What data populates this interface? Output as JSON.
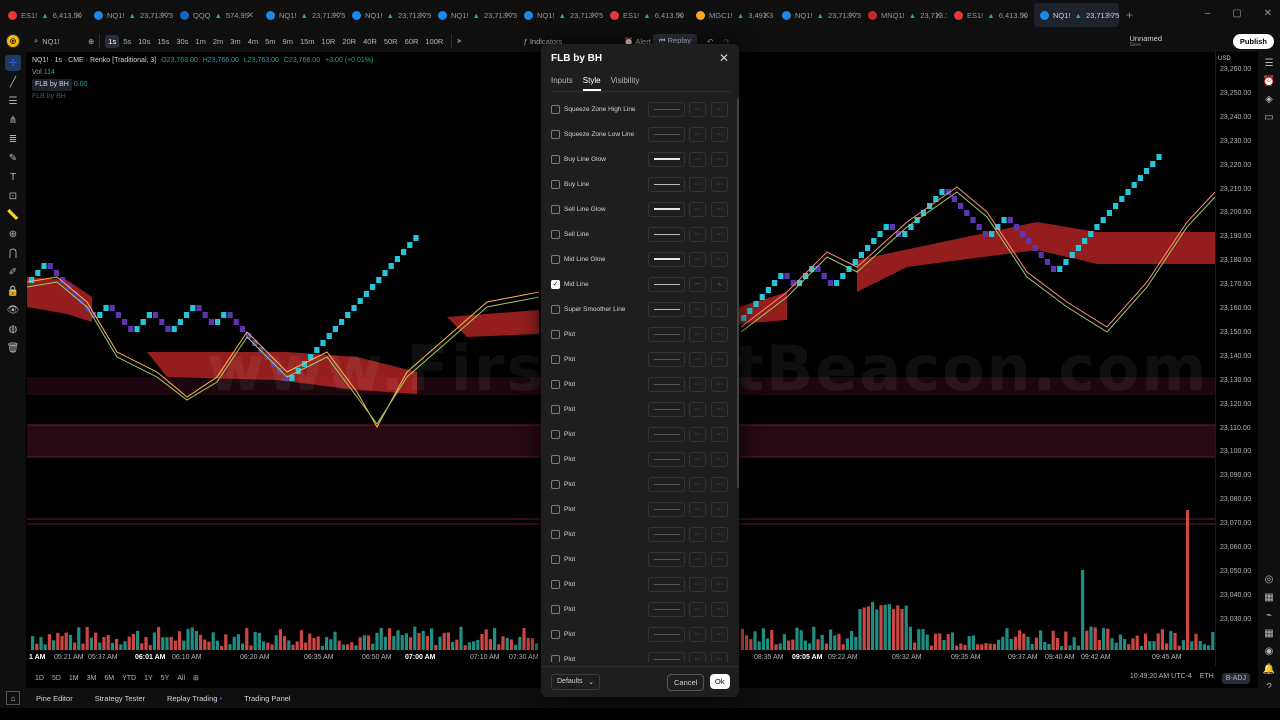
{
  "tabs": [
    {
      "symbol": "ES1!",
      "price": "6,413.50",
      "dot": "#e53935"
    },
    {
      "symbol": "NQ1!",
      "price": "23,713.75",
      "dot": "#1e88e5"
    },
    {
      "symbol": "QQQ",
      "price": "574.95",
      "dot": "#1565c0"
    },
    {
      "symbol": "NQ1!",
      "price": "23,713.75",
      "dot": "#1e88e5"
    },
    {
      "symbol": "NQ1!",
      "price": "23,713.75",
      "dot": "#1e88e5"
    },
    {
      "symbol": "NQ1!",
      "price": "23,713.75",
      "dot": "#1e88e5"
    },
    {
      "symbol": "NQ1!",
      "price": "23,713.75",
      "dot": "#1e88e5"
    },
    {
      "symbol": "ES1!",
      "price": "6,413.50",
      "dot": "#e53935"
    },
    {
      "symbol": "MGC1!",
      "price": "3,491.3",
      "dot": "#f9a825"
    },
    {
      "symbol": "NQ1!",
      "price": "23,713.75",
      "dot": "#1e88e5"
    },
    {
      "symbol": "MNQ1!",
      "price": "23,713.75",
      "dot": "#c62828"
    },
    {
      "symbol": "ES1!",
      "price": "6,413.50",
      "dot": "#e53935"
    },
    {
      "symbol": "NQ1!",
      "price": "23,713.75",
      "dot": "#1e88e5",
      "active": true
    }
  ],
  "toolbar": {
    "symbol": "NQ1!",
    "intervals": [
      "1s",
      "5s",
      "10s",
      "15s",
      "30s",
      "1m",
      "2m",
      "3m",
      "4m",
      "5m",
      "9m",
      "15m",
      "10R",
      "20R",
      "40R",
      "50R",
      "60R",
      "100R"
    ],
    "selected_interval": "1s",
    "indicators": "Indicators",
    "alert": "Alert",
    "replay": "Replay",
    "layout_name": "Unnamed",
    "layout_sub": "Save",
    "publish": "Publish"
  },
  "legend": {
    "title": "NQ1! · 1s · CME · Renko [Traditional, 3]",
    "o": "O23,763.00",
    "h": "H23,766.00",
    "l": "L23,763.00",
    "c": "C23,766.00",
    "chg": "+3.00 (+0.01%)",
    "vol_label": "Vol",
    "vol_value": "114",
    "indicator": "FLB by BH",
    "indicator_value": "0.00",
    "indicator2": "FLB by BH"
  },
  "watermark": "www.FirstLightBeacon.com",
  "price_axis": {
    "currency": "USD",
    "labels": [
      "23,260.00",
      "23,250.00",
      "23,240.00",
      "23,230.00",
      "23,220.00",
      "23,210.00",
      "23,200.00",
      "23,190.00",
      "23,180.00",
      "23,170.00",
      "23,160.00",
      "23,150.00",
      "23,140.00",
      "23,130.00",
      "23,120.00",
      "23,110.00",
      "23,100.00",
      "23,090.00",
      "23,080.00",
      "23,070.00",
      "23,060.00",
      "23,050.00",
      "23,040.00",
      "23,030.00"
    ]
  },
  "time_axis": [
    {
      "label": "1 AM",
      "bold": true
    },
    {
      "label": "05:21 AM"
    },
    {
      "label": "05:37 AM"
    },
    {
      "label": "06:01 AM",
      "bold": true
    },
    {
      "label": "06:10 AM"
    },
    {
      "label": "06:20 AM"
    },
    {
      "label": "06:35 AM"
    },
    {
      "label": "06:50 AM"
    },
    {
      "label": "07:00 AM",
      "bold": true
    },
    {
      "label": "07:10 AM"
    },
    {
      "label": "07:30 AM"
    },
    {
      "label": "08:35 AM"
    },
    {
      "label": "09:05 AM",
      "bold": true
    },
    {
      "label": "09:22 AM"
    },
    {
      "label": "09:32 AM"
    },
    {
      "label": "09:35 AM"
    },
    {
      "label": "09:37 AM"
    },
    {
      "label": "09:40 AM"
    },
    {
      "label": "09:42 AM"
    },
    {
      "label": "09:45 AM"
    }
  ],
  "ranges": [
    "1D",
    "5D",
    "1M",
    "3M",
    "6M",
    "YTD",
    "1Y",
    "5Y",
    "All"
  ],
  "status": {
    "time": "10:49:20 AM UTC-4",
    "session": "ETH",
    "adj": "B-ADJ"
  },
  "bottom_panel": [
    "Pine Editor",
    "Strategy Tester",
    "Replay Trading",
    "Trading Panel"
  ],
  "dialog": {
    "title": "FLB by BH",
    "tabs": [
      "Inputs",
      "Style",
      "Visibility"
    ],
    "active_tab": "Style",
    "rows": [
      {
        "label": "Squeeze Zone High Line",
        "checked": false,
        "glow": false
      },
      {
        "label": "Squeeze Zone Low Line",
        "checked": false,
        "glow": false
      },
      {
        "label": "Buy Line Glow",
        "checked": false,
        "glow": true
      },
      {
        "label": "Buy Line",
        "checked": false,
        "glow": false,
        "bright": true
      },
      {
        "label": "Sell Line Glow",
        "checked": false,
        "glow": true
      },
      {
        "label": "Sell Line",
        "checked": false,
        "glow": false,
        "bright": true
      },
      {
        "label": "Mid Line Glow",
        "checked": false,
        "glow": true
      },
      {
        "label": "Mid Line",
        "checked": true,
        "glow": false,
        "bright": true
      },
      {
        "label": "Super Smoother Line",
        "checked": false,
        "glow": false,
        "bright": true
      },
      {
        "label": "Plot",
        "checked": false
      },
      {
        "label": "Plot",
        "checked": false
      },
      {
        "label": "Plot",
        "checked": false
      },
      {
        "label": "Plot",
        "checked": false
      },
      {
        "label": "Plot",
        "checked": false
      },
      {
        "label": "Plot",
        "checked": false
      },
      {
        "label": "Plot",
        "checked": false
      },
      {
        "label": "Plot",
        "checked": false
      },
      {
        "label": "Plot",
        "checked": false
      },
      {
        "label": "Plot",
        "checked": false
      },
      {
        "label": "Plot",
        "checked": false
      },
      {
        "label": "Plot",
        "checked": false
      },
      {
        "label": "Plot",
        "checked": false
      },
      {
        "label": "Plot",
        "checked": false
      }
    ],
    "defaults": "Defaults",
    "cancel": "Cancel",
    "ok": "Ok"
  },
  "colors": {
    "bull": "#26c6da",
    "bear": "#5e35b1",
    "zone": "#c62828",
    "vol_up": "#26a69a",
    "vol_down": "#ef5350"
  }
}
